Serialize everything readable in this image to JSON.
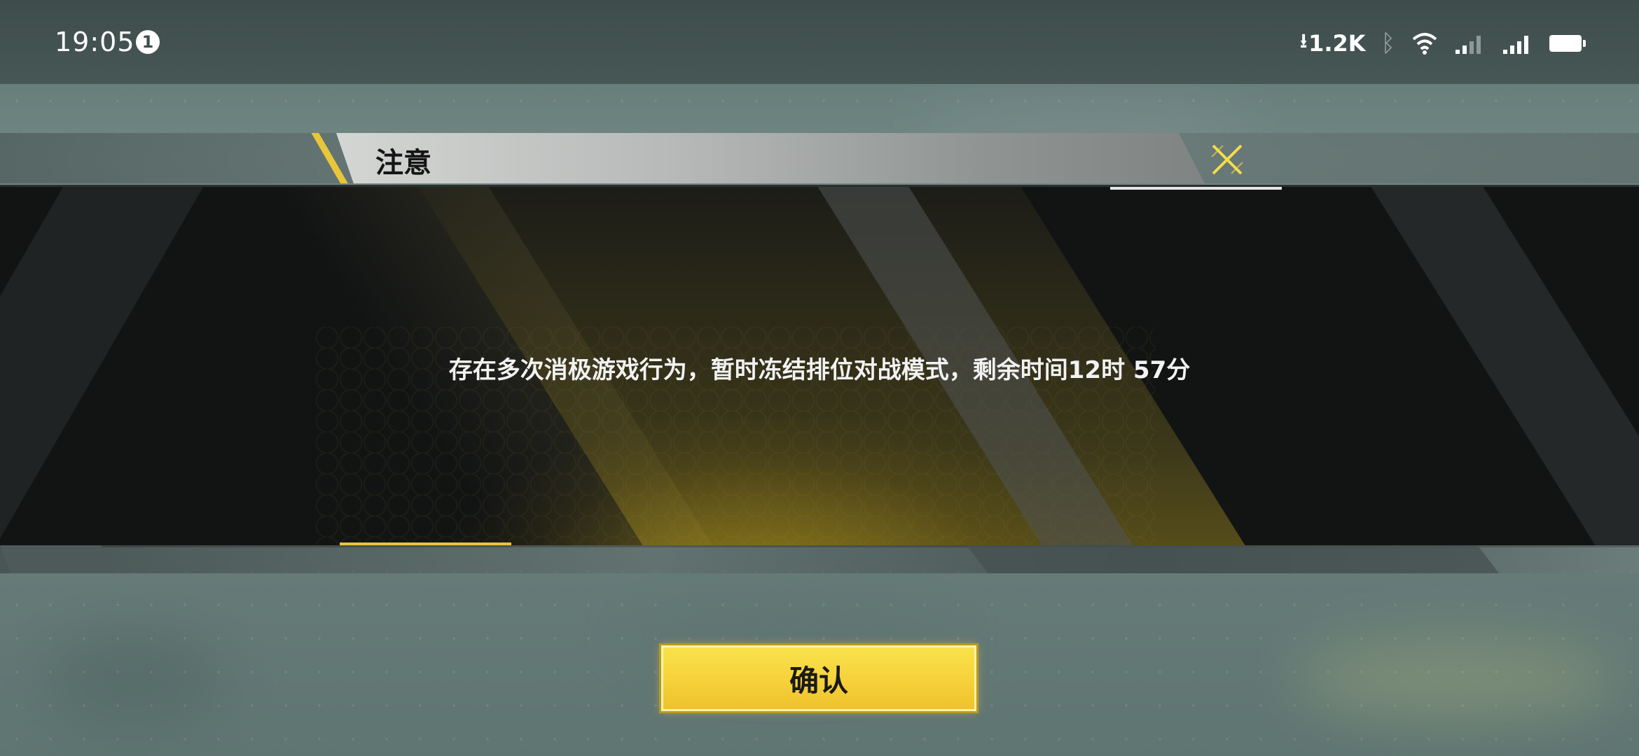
{
  "status_bar": {
    "time": "19:05",
    "notification_count": "1",
    "net_speed": "1.2K",
    "icons": [
      "download-arrow-icon",
      "bluetooth-icon",
      "wifi-icon",
      "signal-icon",
      "signal-2-icon",
      "battery-icon"
    ]
  },
  "dialog": {
    "title": "注意",
    "message": "存在多次消极游戏行为，暂时冻结排位对战模式，剩余时间12时 57分",
    "close_icon": "close-x-icon",
    "confirm_label": "确认"
  },
  "colors": {
    "accent": "#f6d13a",
    "dialog_bg": "#121414",
    "title_bar": "#b5b8b6"
  }
}
